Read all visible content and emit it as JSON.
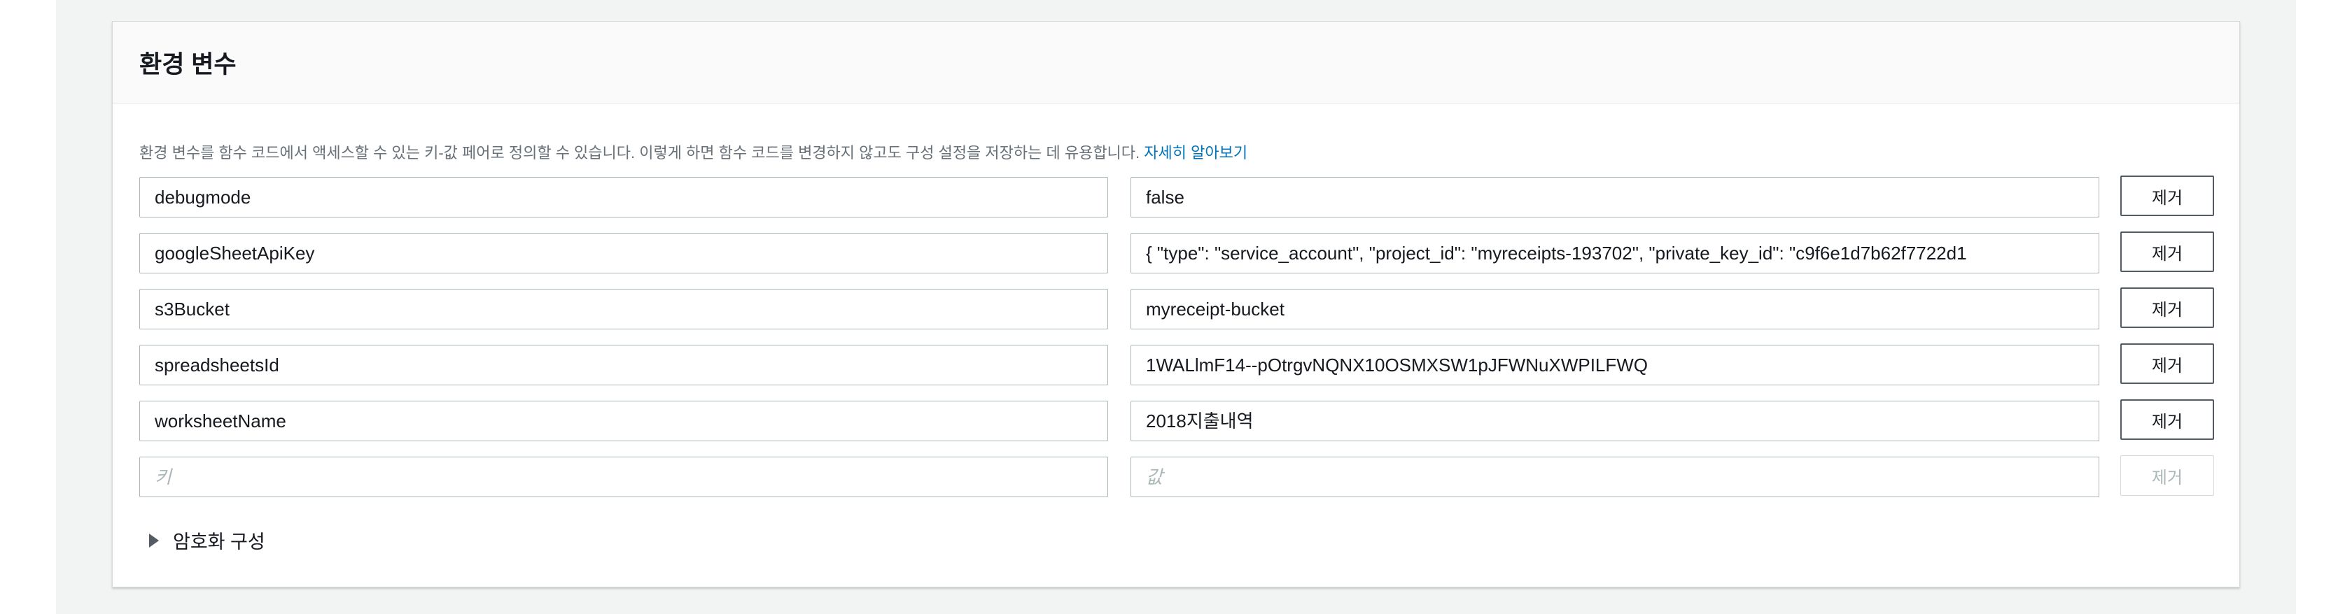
{
  "panel": {
    "title": "환경 변수",
    "description": "환경 변수를 함수 코드에서 액세스할 수 있는 키-값 페어로 정의할 수 있습니다. 이렇게 하면 함수 코드를 변경하지 않고도 구성 설정을 저장하는 데 유용합니다.",
    "learn_more_link": "자세히 알아보기"
  },
  "env_vars": [
    {
      "key": "debugmode",
      "value": "false",
      "remove_label": "제거"
    },
    {
      "key": "googleSheetApiKey",
      "value": "{   \"type\": \"service_account\",   \"project_id\": \"myreceipts-193702\",   \"private_key_id\": \"c9f6e1d7b62f7722d1",
      "remove_label": "제거"
    },
    {
      "key": "s3Bucket",
      "value": "myreceipt-bucket",
      "remove_label": "제거"
    },
    {
      "key": "spreadsheetsId",
      "value": "1WALlmF14--pOtrgvNQNX10OSMXSW1pJFWNuXWPILFWQ",
      "remove_label": "제거"
    },
    {
      "key": "worksheetName",
      "value": "2018지출내역",
      "remove_label": "제거"
    }
  ],
  "new_var": {
    "key_placeholder": "키",
    "value_placeholder": "값",
    "remove_label": "제거"
  },
  "encryption": {
    "label": "암호화 구성",
    "icon": "caret-right-icon"
  },
  "colors": {
    "link": "#0073bb",
    "page_background": "#f2f3f3",
    "header_background": "#fafafa"
  }
}
